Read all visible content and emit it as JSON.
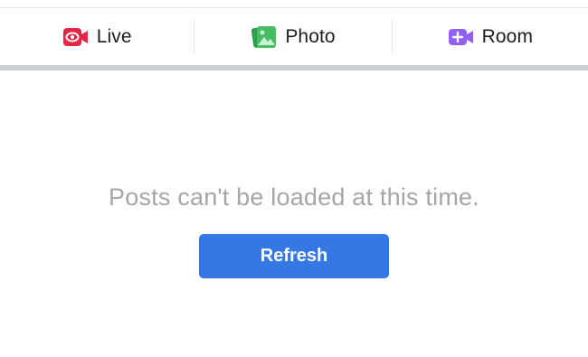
{
  "composer_actions": {
    "live": {
      "label": "Live",
      "icon": "live-video-icon",
      "color": "#e42645"
    },
    "photo": {
      "label": "Photo",
      "icon": "photo-icon",
      "color": "#45bd62"
    },
    "room": {
      "label": "Room",
      "icon": "room-video-icon",
      "color": "#9360f7"
    }
  },
  "feed": {
    "error_message": "Posts can't be loaded at this time.",
    "refresh_label": "Refresh"
  },
  "colors": {
    "primary_button": "#3578e5",
    "separator": "#ccd0d5",
    "muted_text": "#a3a6ab"
  }
}
